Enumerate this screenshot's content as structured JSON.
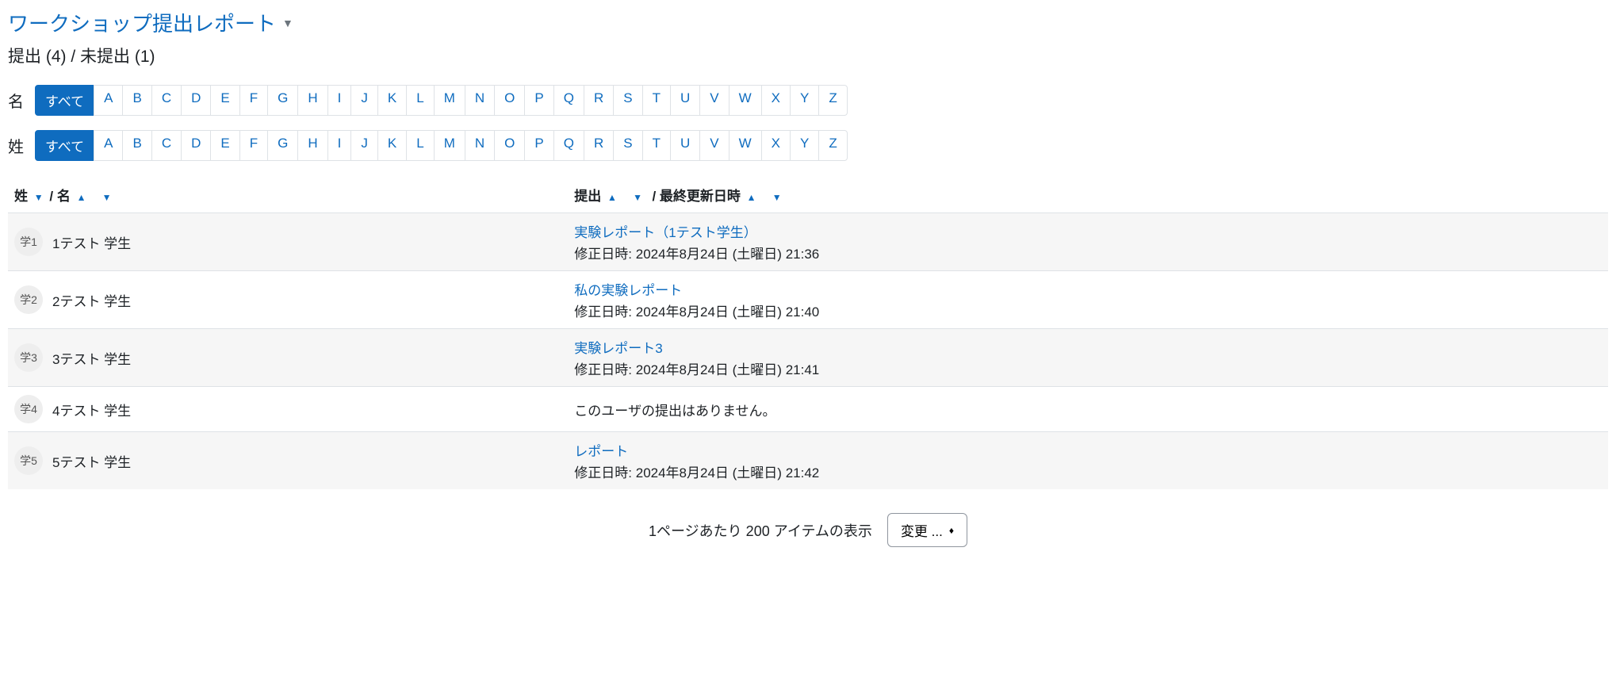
{
  "header": {
    "title": "ワークショップ提出レポート",
    "subtitle": "提出 (4) / 未提出 (1)"
  },
  "filters": {
    "first_name_label": "名",
    "last_name_label": "姓",
    "all_label": "すべて",
    "letters": [
      "A",
      "B",
      "C",
      "D",
      "E",
      "F",
      "G",
      "H",
      "I",
      "J",
      "K",
      "L",
      "M",
      "N",
      "O",
      "P",
      "Q",
      "R",
      "S",
      "T",
      "U",
      "V",
      "W",
      "X",
      "Y",
      "Z"
    ]
  },
  "table": {
    "col_lastname": "姓",
    "col_firstname": "名",
    "col_submission": "提出",
    "col_lastmod": "最終更新日時",
    "separator": "/",
    "modified_prefix": "修正日時: ",
    "rows": [
      {
        "avatar": "学1",
        "name": "1テスト 学生",
        "submission_title": "実験レポート（1テスト学生）",
        "modified": "2024年8月24日 (土曜日) 21:36",
        "has_submission": true
      },
      {
        "avatar": "学2",
        "name": "2テスト 学生",
        "submission_title": "私の実験レポート",
        "modified": "2024年8月24日 (土曜日) 21:40",
        "has_submission": true
      },
      {
        "avatar": "学3",
        "name": "3テスト 学生",
        "submission_title": "実験レポート3",
        "modified": "2024年8月24日 (土曜日) 21:41",
        "has_submission": true
      },
      {
        "avatar": "学4",
        "name": "4テスト 学生",
        "no_submission_text": "このユーザの提出はありません。",
        "has_submission": false
      },
      {
        "avatar": "学5",
        "name": "5テスト 学生",
        "submission_title": "レポート",
        "modified": "2024年8月24日 (土曜日) 21:42",
        "has_submission": true
      }
    ]
  },
  "footer": {
    "text": "1ページあたり 200 アイテムの表示",
    "change_label": "変更 ..."
  }
}
